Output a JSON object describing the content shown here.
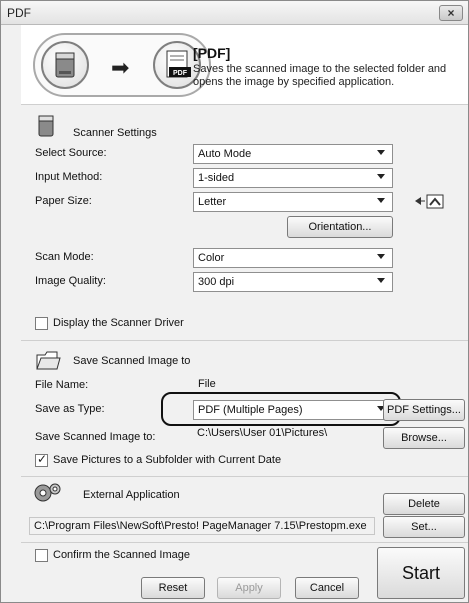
{
  "window": {
    "title": "PDF",
    "close_label": "×"
  },
  "header": {
    "title": "[PDF]",
    "description": "Saves the scanned image to the selected folder and opens the image by specified application.",
    "arrow": "➡",
    "pdf_badge": "PDF"
  },
  "scanner": {
    "heading": "Scanner Settings",
    "select_source_label": "Select Source:",
    "select_source_value": "Auto Mode",
    "input_method_label": "Input Method:",
    "input_method_value": "1-sided",
    "paper_size_label": "Paper Size:",
    "paper_size_value": "Letter",
    "orientation_button": "Orientation...",
    "scan_mode_label": "Scan Mode:",
    "scan_mode_value": "Color",
    "image_quality_label": "Image Quality:",
    "image_quality_value": "300 dpi",
    "display_driver_label": "Display the Scanner Driver"
  },
  "save": {
    "heading": "Save Scanned Image to",
    "file_name_label": "File Name:",
    "file_name_value": "File",
    "save_as_type_label": "Save as Type:",
    "save_as_type_value": "PDF (Multiple Pages)",
    "pdf_settings_button": "PDF Settings...",
    "save_to_label": "Save Scanned Image to:",
    "save_to_value": "C:\\Users\\User 01\\Pictures\\",
    "browse_button": "Browse...",
    "subfolder_label": "Save Pictures to a Subfolder with Current Date"
  },
  "external": {
    "heading": "External Application",
    "delete_button": "Delete",
    "path_value": "C:\\Program Files\\NewSoft\\Presto! PageManager 7.15\\Prestopm.exe",
    "set_button": "Set..."
  },
  "footer": {
    "confirm_label": "Confirm the Scanned Image",
    "reset_button": "Reset",
    "apply_button": "Apply",
    "cancel_button": "Cancel",
    "start_button": "Start"
  }
}
